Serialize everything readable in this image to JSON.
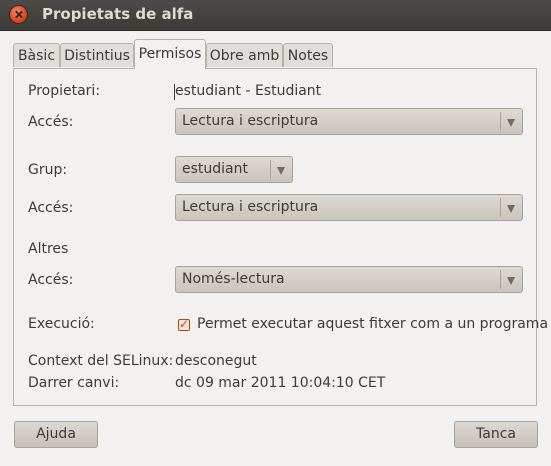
{
  "window": {
    "title": "Propietats de alfa"
  },
  "tabs": [
    {
      "label": "Bàsic"
    },
    {
      "label": "Distintius"
    },
    {
      "label": "Permisos",
      "active": true
    },
    {
      "label": "Obre amb"
    },
    {
      "label": "Notes"
    }
  ],
  "permissions": {
    "owner_label": "Propietari:",
    "owner_value": "estudiant - Estudiant",
    "owner_access_label": "Accés:",
    "owner_access_value": "Lectura i escriptura",
    "group_label": "Grup:",
    "group_value": "estudiant",
    "group_access_label": "Accés:",
    "group_access_value": "Lectura i escriptura",
    "others_label": "Altres",
    "others_access_label": "Accés:",
    "others_access_value": "Només-lectura",
    "execution_label": "Execució:",
    "execution_checkbox_label": "Permet executar aquest fitxer com a un programa",
    "execution_checked": true,
    "selinux_label": "Context del SELinux:",
    "selinux_value": "desconegut",
    "last_change_label": "Darrer canvi:",
    "last_change_value": "dc 09 mar 2011 10:04:10 CET"
  },
  "buttons": {
    "help": "Ajuda",
    "cancel": "Tanca"
  },
  "icons": {
    "close": "close-icon",
    "dropdown": "dropdown-arrow-icon",
    "check": "checkmark-icon"
  }
}
